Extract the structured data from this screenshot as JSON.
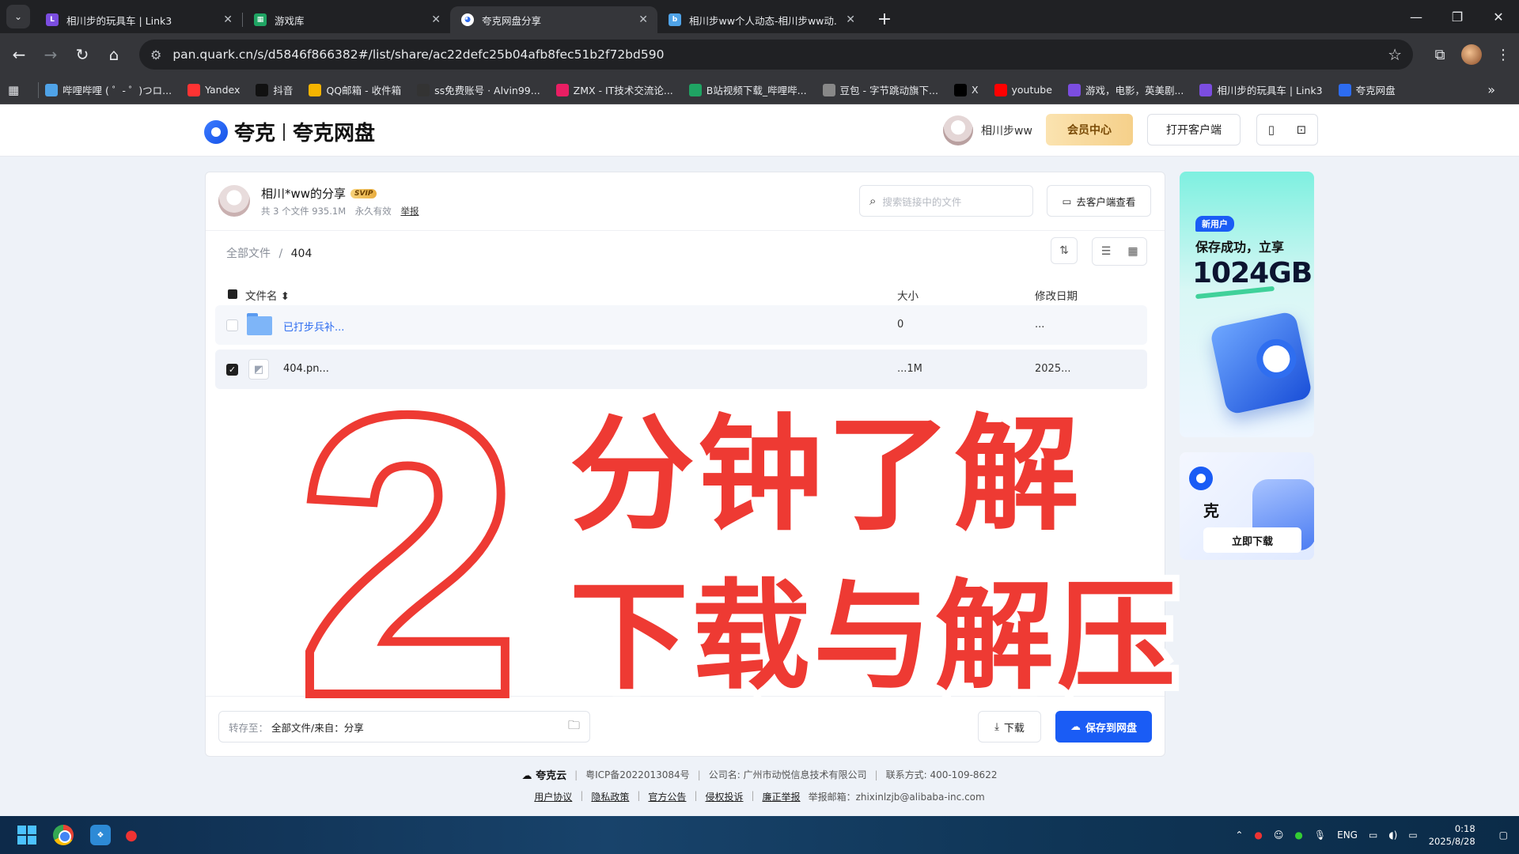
{
  "browser": {
    "tabs": [
      {
        "title": "相川步的玩具车 | Link3",
        "icon": "link3-icon",
        "color": "#7b4de0",
        "active": false
      },
      {
        "title": "游戏库",
        "icon": "game-library-icon",
        "color": "#1fa463",
        "active": false
      },
      {
        "title": "夸克网盘分享",
        "icon": "quark-icon",
        "color": "#ffffff",
        "active": true
      },
      {
        "title": "相川步ww个人动态-相川步ww动...",
        "icon": "bilibili-icon",
        "color": "#4fa3e8",
        "active": false
      }
    ],
    "url": "pan.quark.cn/s/d5846f866382#/list/share/ac22defc25b04afb8fec51b2f72bd590",
    "bookmarks": [
      {
        "label": "哔哩哔哩 ( ゜- ゜)つロ...",
        "color": "#4fa3e8",
        "icon": "bilibili-icon"
      },
      {
        "label": "Yandex",
        "color": "#f33",
        "icon": "yandex-icon"
      },
      {
        "label": "抖音",
        "color": "#111",
        "icon": "douyin-icon"
      },
      {
        "label": "QQ邮箱 - 收件箱",
        "color": "#f5b400",
        "icon": "qq-mail-icon"
      },
      {
        "label": "ss免费账号 · Alvin99...",
        "color": "#333",
        "icon": "github-icon"
      },
      {
        "label": "ZMX - IT技术交流论...",
        "color": "#e91e63",
        "icon": "zmx-icon"
      },
      {
        "label": "B站视频下载_哔哩哔...",
        "color": "#1fa463",
        "icon": "bdownload-icon"
      },
      {
        "label": "豆包 - 字节跳动旗下...",
        "color": "#888",
        "icon": "doubao-icon"
      },
      {
        "label": "X",
        "color": "#000",
        "icon": "x-icon"
      },
      {
        "label": "youtube",
        "color": "#f00",
        "icon": "youtube-icon"
      },
      {
        "label": "游戏，电影，英美剧...",
        "color": "#7b4de0",
        "icon": "games-icon"
      },
      {
        "label": "相川步的玩具车 | Link3",
        "color": "#7b4de0",
        "icon": "link3-icon"
      },
      {
        "label": "夸克网盘",
        "color": "#2d6cf0",
        "icon": "quark-icon"
      }
    ]
  },
  "header": {
    "logo": "夸克",
    "product": "夸克网盘",
    "username": "相川步ww",
    "vip_button": "会员中心",
    "open_client": "打开客户端"
  },
  "share": {
    "title": "相川*ww的分享",
    "badge": "SVIP",
    "file_count": "共 3 个文件 935.1M",
    "validity": "永久有效",
    "report": "举报",
    "search_placeholder": "搜索链接中的文件",
    "to_client": "去客户端查看",
    "breadcrumb_root": "全部文件",
    "breadcrumb_sep": "/",
    "breadcrumb_current": "404",
    "columns": {
      "name": "文件名",
      "size": "大小",
      "date": "修改日期"
    },
    "rows": [
      {
        "name": "已打步兵补...",
        "size": "0",
        "date": "...",
        "type": "folder",
        "checked": false
      },
      {
        "name": "404.pn...",
        "size": "...1M",
        "date": "2025...",
        "type": "image",
        "checked": true
      }
    ],
    "save_to_label": "转存至：",
    "save_to_value": "全部文件/来自：分享",
    "download": "下载",
    "save_to_drive": "保存到网盘"
  },
  "ads": {
    "new_user": "新用户",
    "line1": "保存成功，立享",
    "big": "1024GB",
    "brand_short": "克",
    "download_now": "立即下载"
  },
  "overlay": {
    "number": "2",
    "line1": "分钟了解",
    "line2": "下载与解压"
  },
  "footer": {
    "brand": "夸克云",
    "icp": "粤ICP备2022013084号",
    "company": "公司名: 广州市动悦信息技术有限公司",
    "contact": "联系方式: 400-109-8622",
    "links": [
      "用户协议",
      "隐私政策",
      "官方公告",
      "侵权投诉",
      "廉正举报"
    ],
    "report_email": "举报邮箱：zhixinlzjb@alibaba-inc.com"
  },
  "taskbar": {
    "lang": "ENG",
    "time": "0:18",
    "date": "2025/8/28"
  }
}
